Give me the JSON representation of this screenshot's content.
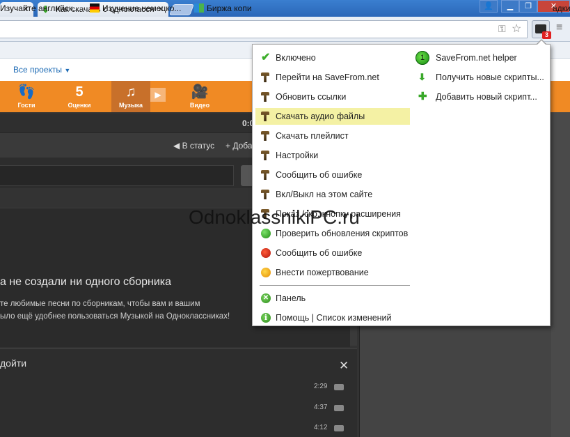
{
  "browser": {
    "tabs": [
      {
        "label": ""
      },
      {
        "label": "Как скачать с одноклассн"
      }
    ],
    "extension_badge": "3"
  },
  "bookmarks": [
    {
      "label": "Изучайте английск..."
    },
    {
      "label": "Изучение немецко..."
    },
    {
      "label": "Биржа копи"
    },
    {
      "label": "адки"
    }
  ],
  "page": {
    "all_projects": "Все проекты",
    "nav": [
      {
        "label": "Гости",
        "glyph": "👣"
      },
      {
        "label": "Оценки",
        "glyph": "5"
      },
      {
        "label": "Музыка",
        "glyph": "♫"
      },
      {
        "label": "Видео",
        "glyph": "🎥"
      }
    ],
    "player_time": "0:0",
    "status_label": "В статус",
    "add_label": "+ Добав",
    "empty_title": "а не создали ни одного сборника",
    "empty_desc_1": "те любимые песни по сборникам, чтобы вам и вашим",
    "empty_desc_2": "ыло ещё удобнее пользоваться Музыкой на Одноклассниках!",
    "playlist_title": "дойти",
    "durations": [
      "2:29",
      "4:37",
      "4:12"
    ]
  },
  "popup": {
    "left_items": [
      {
        "label": "Включено",
        "icon": "check-icon"
      },
      {
        "label": "Перейти на SaveFrom.net",
        "icon": "tool-icon"
      },
      {
        "label": "Обновить ссылки",
        "icon": "tool-icon"
      },
      {
        "label": "Скачать аудио файлы",
        "icon": "tool-icon",
        "highlighted": true
      },
      {
        "label": "Скачать плейлист",
        "icon": "tool-icon"
      },
      {
        "label": "Настройки",
        "icon": "tool-icon"
      },
      {
        "label": "Сообщить об ошибке",
        "icon": "tool-icon"
      },
      {
        "label": "Вкл/Выкл на этом сайте",
        "icon": "tool-icon"
      },
      {
        "label": "Показ./скр. кнопку расширения",
        "icon": "tool-icon"
      },
      {
        "label": "Проверить обновления скриптов",
        "icon": "refresh-icon"
      },
      {
        "label": "Сообщить об ошибке",
        "icon": "bug-icon"
      },
      {
        "label": "Внести пожертвование",
        "icon": "smile-icon"
      }
    ],
    "bottom_items": [
      {
        "label": "Панель",
        "icon": "panel-icon"
      },
      {
        "label": "Помощь | Список изменений",
        "icon": "info-icon"
      }
    ],
    "right_items": [
      {
        "label": "SaveFrom.net helper",
        "icon": "helper-icon",
        "badge": "1"
      },
      {
        "label": "Получить новые скрипты...",
        "icon": "download-icon"
      },
      {
        "label": "Добавить новый скрипт...",
        "icon": "plus-icon"
      }
    ]
  },
  "watermark": "OdnoklassnikiPC.ru"
}
